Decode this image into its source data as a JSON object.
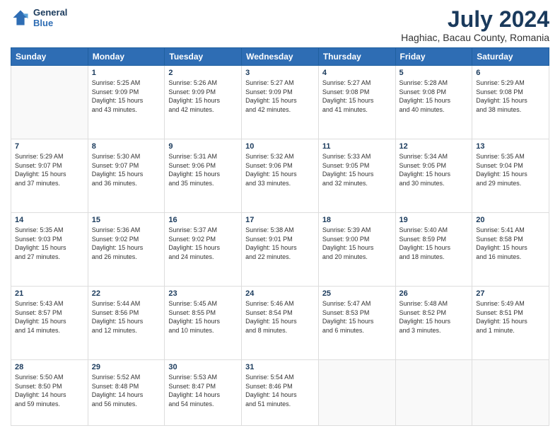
{
  "logo": {
    "line1": "General",
    "line2": "Blue"
  },
  "title": "July 2024",
  "subtitle": "Haghiac, Bacau County, Romania",
  "weekdays": [
    "Sunday",
    "Monday",
    "Tuesday",
    "Wednesday",
    "Thursday",
    "Friday",
    "Saturday"
  ],
  "weeks": [
    [
      {
        "day": "",
        "content": ""
      },
      {
        "day": "1",
        "content": "Sunrise: 5:25 AM\nSunset: 9:09 PM\nDaylight: 15 hours\nand 43 minutes."
      },
      {
        "day": "2",
        "content": "Sunrise: 5:26 AM\nSunset: 9:09 PM\nDaylight: 15 hours\nand 42 minutes."
      },
      {
        "day": "3",
        "content": "Sunrise: 5:27 AM\nSunset: 9:09 PM\nDaylight: 15 hours\nand 42 minutes."
      },
      {
        "day": "4",
        "content": "Sunrise: 5:27 AM\nSunset: 9:08 PM\nDaylight: 15 hours\nand 41 minutes."
      },
      {
        "day": "5",
        "content": "Sunrise: 5:28 AM\nSunset: 9:08 PM\nDaylight: 15 hours\nand 40 minutes."
      },
      {
        "day": "6",
        "content": "Sunrise: 5:29 AM\nSunset: 9:08 PM\nDaylight: 15 hours\nand 38 minutes."
      }
    ],
    [
      {
        "day": "7",
        "content": "Sunrise: 5:29 AM\nSunset: 9:07 PM\nDaylight: 15 hours\nand 37 minutes."
      },
      {
        "day": "8",
        "content": "Sunrise: 5:30 AM\nSunset: 9:07 PM\nDaylight: 15 hours\nand 36 minutes."
      },
      {
        "day": "9",
        "content": "Sunrise: 5:31 AM\nSunset: 9:06 PM\nDaylight: 15 hours\nand 35 minutes."
      },
      {
        "day": "10",
        "content": "Sunrise: 5:32 AM\nSunset: 9:06 PM\nDaylight: 15 hours\nand 33 minutes."
      },
      {
        "day": "11",
        "content": "Sunrise: 5:33 AM\nSunset: 9:05 PM\nDaylight: 15 hours\nand 32 minutes."
      },
      {
        "day": "12",
        "content": "Sunrise: 5:34 AM\nSunset: 9:05 PM\nDaylight: 15 hours\nand 30 minutes."
      },
      {
        "day": "13",
        "content": "Sunrise: 5:35 AM\nSunset: 9:04 PM\nDaylight: 15 hours\nand 29 minutes."
      }
    ],
    [
      {
        "day": "14",
        "content": "Sunrise: 5:35 AM\nSunset: 9:03 PM\nDaylight: 15 hours\nand 27 minutes."
      },
      {
        "day": "15",
        "content": "Sunrise: 5:36 AM\nSunset: 9:02 PM\nDaylight: 15 hours\nand 26 minutes."
      },
      {
        "day": "16",
        "content": "Sunrise: 5:37 AM\nSunset: 9:02 PM\nDaylight: 15 hours\nand 24 minutes."
      },
      {
        "day": "17",
        "content": "Sunrise: 5:38 AM\nSunset: 9:01 PM\nDaylight: 15 hours\nand 22 minutes."
      },
      {
        "day": "18",
        "content": "Sunrise: 5:39 AM\nSunset: 9:00 PM\nDaylight: 15 hours\nand 20 minutes."
      },
      {
        "day": "19",
        "content": "Sunrise: 5:40 AM\nSunset: 8:59 PM\nDaylight: 15 hours\nand 18 minutes."
      },
      {
        "day": "20",
        "content": "Sunrise: 5:41 AM\nSunset: 8:58 PM\nDaylight: 15 hours\nand 16 minutes."
      }
    ],
    [
      {
        "day": "21",
        "content": "Sunrise: 5:43 AM\nSunset: 8:57 PM\nDaylight: 15 hours\nand 14 minutes."
      },
      {
        "day": "22",
        "content": "Sunrise: 5:44 AM\nSunset: 8:56 PM\nDaylight: 15 hours\nand 12 minutes."
      },
      {
        "day": "23",
        "content": "Sunrise: 5:45 AM\nSunset: 8:55 PM\nDaylight: 15 hours\nand 10 minutes."
      },
      {
        "day": "24",
        "content": "Sunrise: 5:46 AM\nSunset: 8:54 PM\nDaylight: 15 hours\nand 8 minutes."
      },
      {
        "day": "25",
        "content": "Sunrise: 5:47 AM\nSunset: 8:53 PM\nDaylight: 15 hours\nand 6 minutes."
      },
      {
        "day": "26",
        "content": "Sunrise: 5:48 AM\nSunset: 8:52 PM\nDaylight: 15 hours\nand 3 minutes."
      },
      {
        "day": "27",
        "content": "Sunrise: 5:49 AM\nSunset: 8:51 PM\nDaylight: 15 hours\nand 1 minute."
      }
    ],
    [
      {
        "day": "28",
        "content": "Sunrise: 5:50 AM\nSunset: 8:50 PM\nDaylight: 14 hours\nand 59 minutes."
      },
      {
        "day": "29",
        "content": "Sunrise: 5:52 AM\nSunset: 8:48 PM\nDaylight: 14 hours\nand 56 minutes."
      },
      {
        "day": "30",
        "content": "Sunrise: 5:53 AM\nSunset: 8:47 PM\nDaylight: 14 hours\nand 54 minutes."
      },
      {
        "day": "31",
        "content": "Sunrise: 5:54 AM\nSunset: 8:46 PM\nDaylight: 14 hours\nand 51 minutes."
      },
      {
        "day": "",
        "content": ""
      },
      {
        "day": "",
        "content": ""
      },
      {
        "day": "",
        "content": ""
      }
    ]
  ]
}
